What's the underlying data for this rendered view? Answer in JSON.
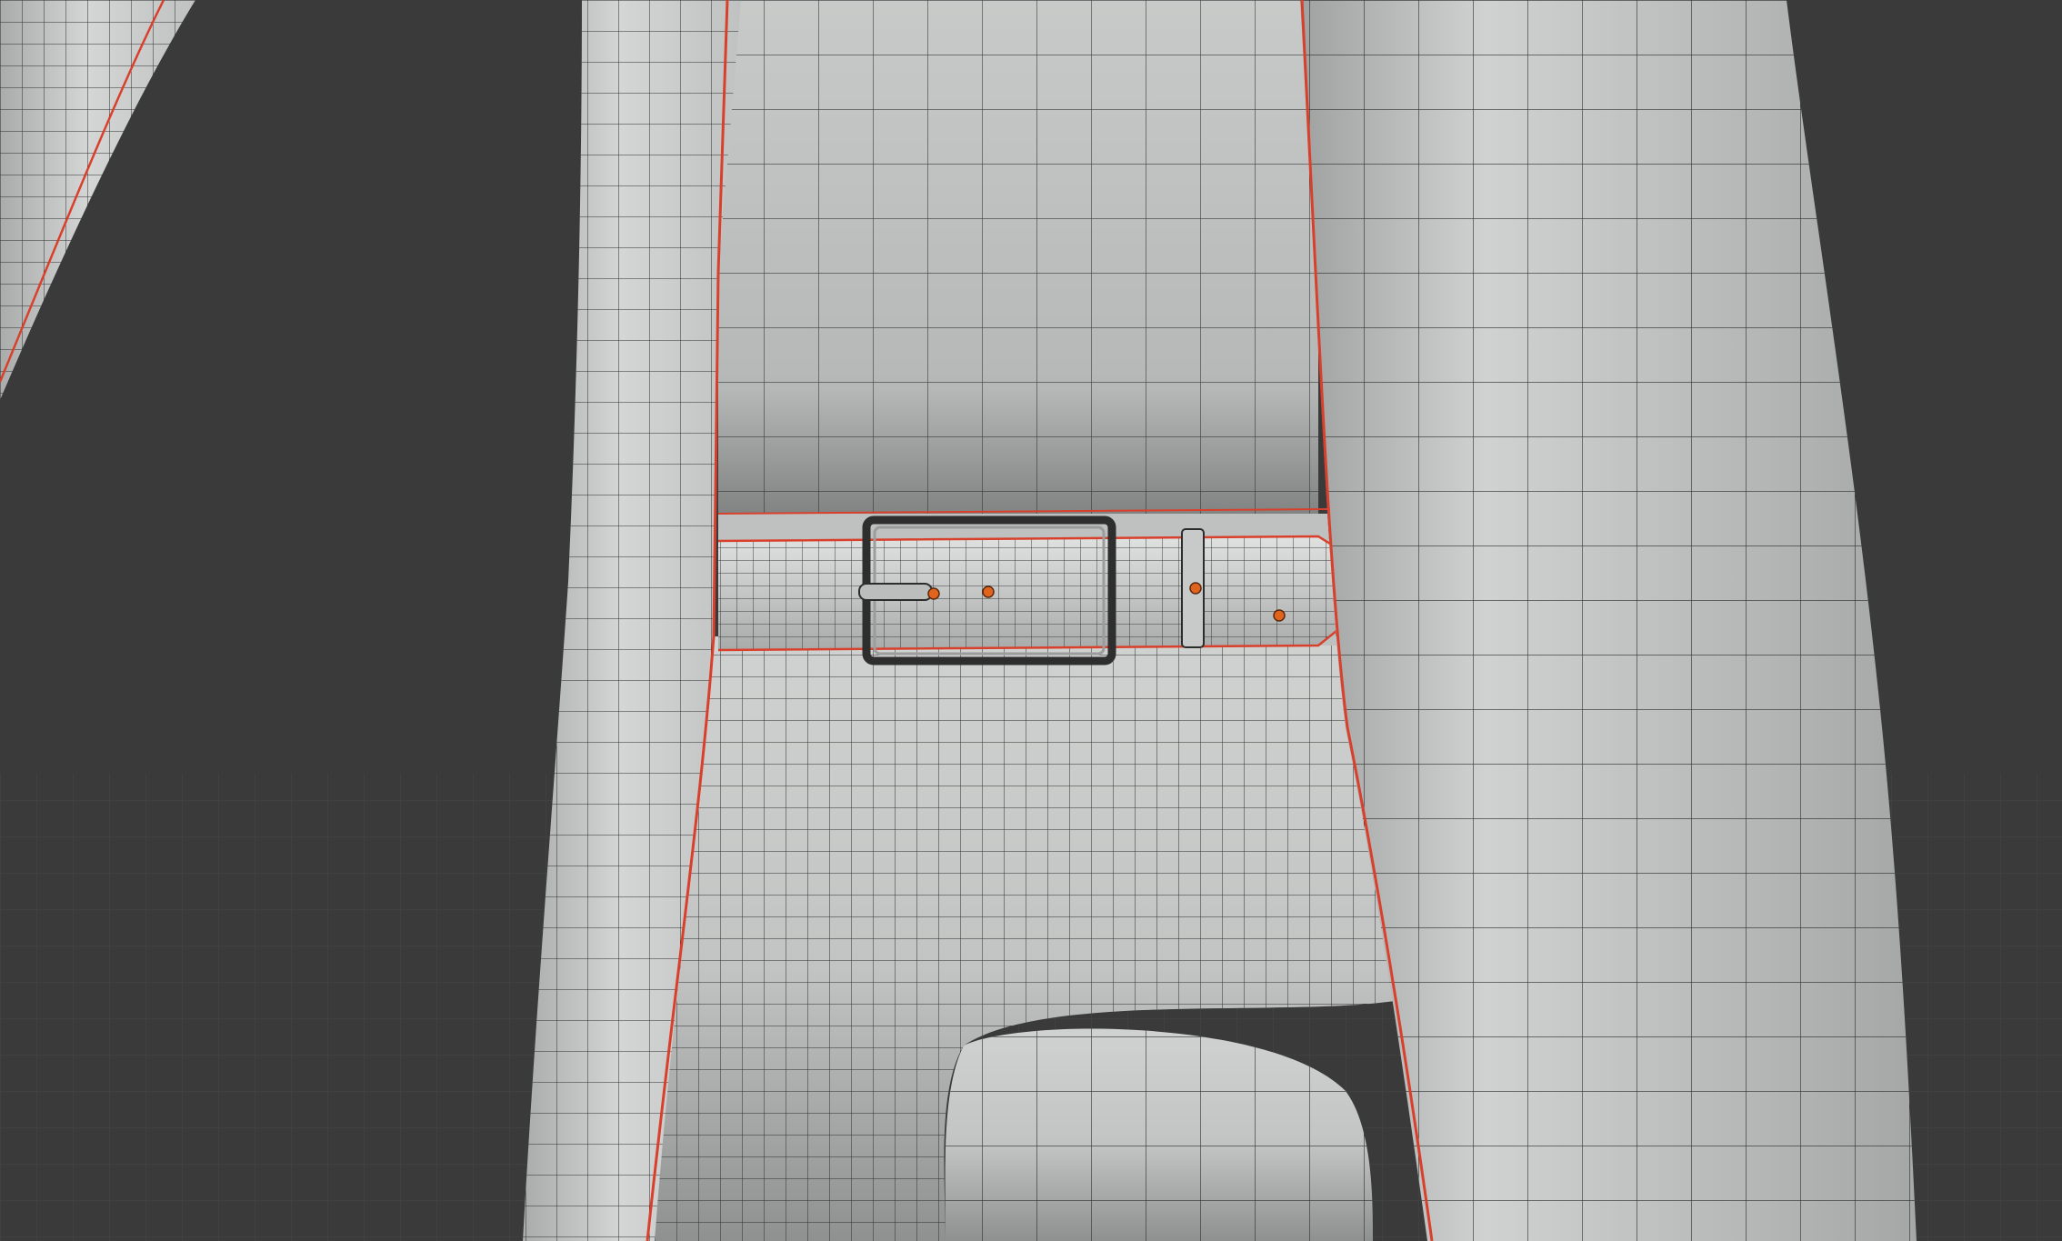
{
  "viewport": {
    "mode": "3d-viewport-wireframe-overlay",
    "shading": "solid",
    "background_color": "#3a3a3a",
    "floor_grid_color": "#4a4a4a",
    "mesh_color": "#c9cbca",
    "wire_color": "#2c2c2c",
    "seam_color": "#d9402c",
    "selected_vertex_color": "#e0641e"
  },
  "objects": [
    {
      "name": "arm-left",
      "icon": "mesh-icon"
    },
    {
      "name": "coat-left-panel",
      "icon": "mesh-icon"
    },
    {
      "name": "coat-right-panel",
      "icon": "mesh-icon"
    },
    {
      "name": "torso-upper",
      "icon": "mesh-icon"
    },
    {
      "name": "belt",
      "icon": "mesh-icon"
    },
    {
      "name": "belt-buckle",
      "icon": "mesh-icon"
    },
    {
      "name": "belt-loop",
      "icon": "mesh-icon"
    },
    {
      "name": "pants",
      "icon": "mesh-icon"
    }
  ],
  "belt_holes": 4
}
